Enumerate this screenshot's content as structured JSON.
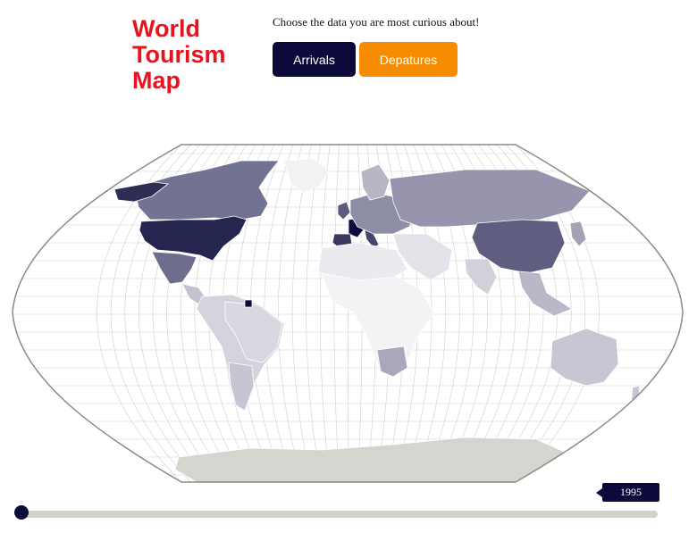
{
  "header": {
    "title": "World\nTourism\nMap",
    "prompt": "Choose the data you are most curious about!"
  },
  "buttons": {
    "arrivals_label": "Arrivals",
    "departures_label": "Depatures"
  },
  "slider": {
    "year_label": "1995",
    "position_fraction": 0.0
  },
  "colors": {
    "title": "#e8131f",
    "arrivals_button": "#0c0a3a",
    "departures_button": "#f78c00",
    "slider_track": "#d5d2cc",
    "slider_thumb": "#0c0a3a",
    "ocean": "#ffffff",
    "graticule": "#cfcfcf",
    "outline": "#8c8a84",
    "antarctica": "#d6d4ce",
    "no_data": "#f4f4f4"
  },
  "map": {
    "projection": "Eckert III style world outline with graticule",
    "selected_dataset": "Arrivals",
    "regions": [
      {
        "name": "Canada",
        "color": "#727292"
      },
      {
        "name": "Alaska",
        "color": "#2e2e55"
      },
      {
        "name": "United States",
        "color": "#24264f"
      },
      {
        "name": "Mexico",
        "color": "#6e6d8c"
      },
      {
        "name": "Central America",
        "color": "#c2c1cd"
      },
      {
        "name": "Greenland",
        "color": "#f2f2f4"
      },
      {
        "name": "South America",
        "color": "#d4d3dc"
      },
      {
        "name": "Brazil",
        "color": "#d9d8e0"
      },
      {
        "name": "Argentina",
        "color": "#c6c5d1"
      },
      {
        "name": "France",
        "color": "#0c0a3a"
      },
      {
        "name": "Spain",
        "color": "#3a3a60"
      },
      {
        "name": "United Kingdom",
        "color": "#5a5a7d"
      },
      {
        "name": "Italy",
        "color": "#47476b"
      },
      {
        "name": "Europe",
        "color": "#8e8da6"
      },
      {
        "name": "Scandinavia",
        "color": "#b7b6c5"
      },
      {
        "name": "Russia",
        "color": "#9695ad"
      },
      {
        "name": "China",
        "color": "#5f5e80"
      },
      {
        "name": "India",
        "color": "#d2d1da"
      },
      {
        "name": "Middle East",
        "color": "#e3e2e8"
      },
      {
        "name": "North Africa",
        "color": "#ebebef"
      },
      {
        "name": "Africa",
        "color": "#f3f3f5"
      },
      {
        "name": "South Africa",
        "color": "#a9a8ba"
      },
      {
        "name": "Southeast Asia",
        "color": "#b9b8c7"
      },
      {
        "name": "Japan",
        "color": "#a4a3b6"
      },
      {
        "name": "Australia",
        "color": "#c7c6d2"
      },
      {
        "name": "New Zealand",
        "color": "#c7c6d2"
      },
      {
        "name": "Caribbean",
        "color": "#0c0a3a"
      },
      {
        "name": "Antarctica",
        "color": "#d6d4ce"
      }
    ]
  }
}
